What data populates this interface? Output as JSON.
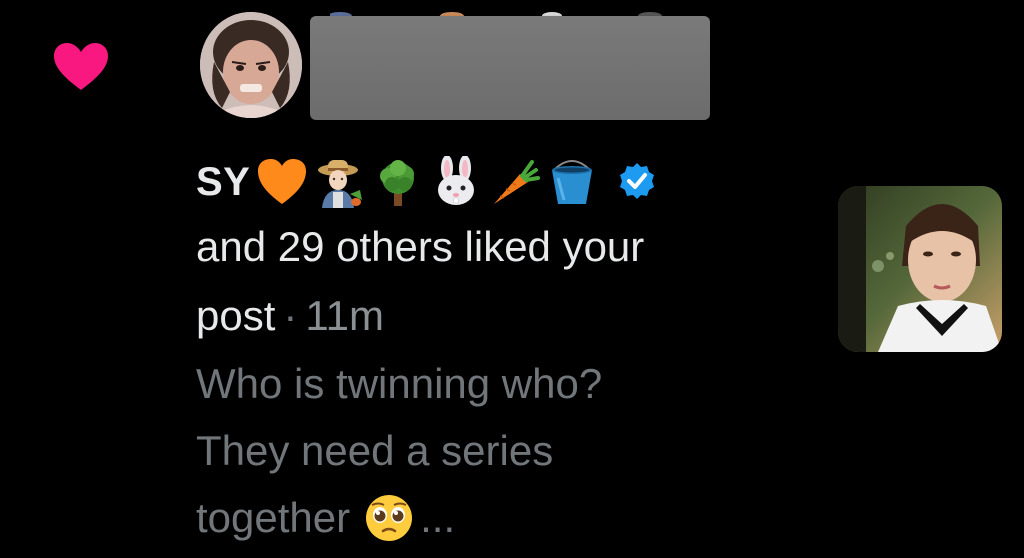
{
  "notification": {
    "type_icon": "heart-icon",
    "user_name": "SY",
    "name_emojis": [
      "orange-heart-emoji",
      "woman-farmer-emoji",
      "tree-emoji",
      "rabbit-face-emoji",
      "carrot-emoji",
      "bucket-emoji"
    ],
    "verified_icon": "verified-badge-icon",
    "others_text": "and 29 others liked your",
    "post_word": "post",
    "separator": "·",
    "time_ago": "11m",
    "snippet_line1": "Who is twinning who?",
    "snippet_line2": "They need a series",
    "snippet_line3": "together",
    "snippet_emoji": "pleading-face-emoji",
    "ellipsis": "..."
  },
  "colors": {
    "background": "#000000",
    "primary_text": "#e7e9ea",
    "secondary_text": "#71767b",
    "like_pink": "#f91880",
    "verified_blue": "#1d9bf0"
  }
}
